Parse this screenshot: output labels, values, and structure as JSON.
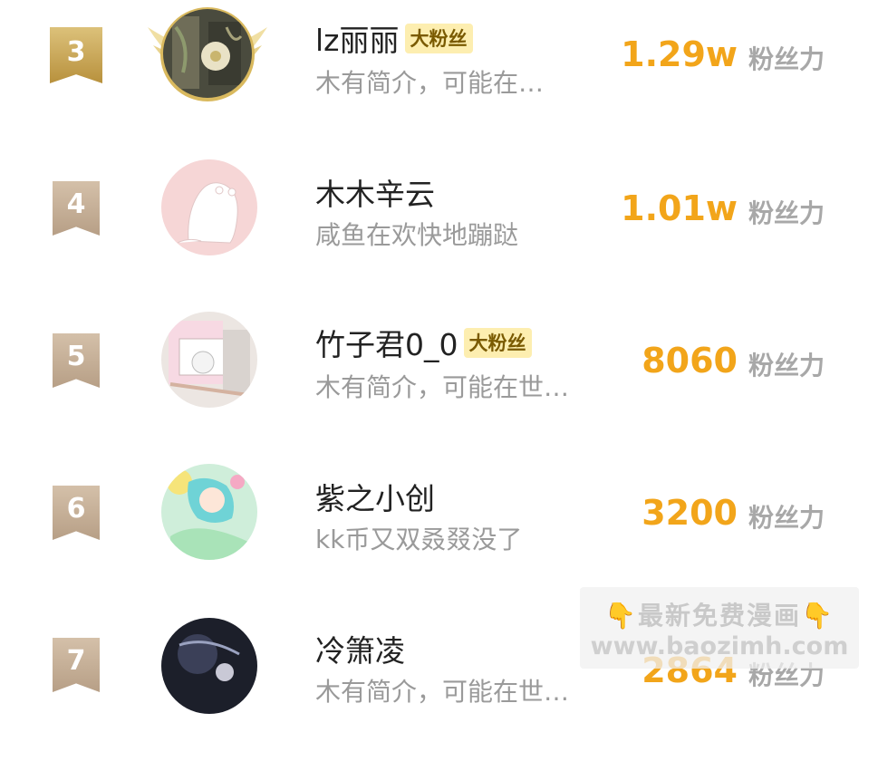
{
  "users": [
    {
      "rank": "3",
      "name": "lz丽丽",
      "badge": "大粉丝",
      "bio": "木有简介，可能在…",
      "score": "1.29w",
      "score_label": "粉丝力"
    },
    {
      "rank": "4",
      "name": "木木辛云",
      "badge": "",
      "bio": "咸鱼在欢快地蹦跶",
      "score": "1.01w",
      "score_label": "粉丝力"
    },
    {
      "rank": "5",
      "name": "竹子君0_0",
      "badge": "大粉丝",
      "bio": "木有简介，可能在世…",
      "score": "8060",
      "score_label": "粉丝力"
    },
    {
      "rank": "6",
      "name": "紫之小创",
      "badge": "",
      "bio": "kk币又双叒叕没了",
      "score": "3200",
      "score_label": "粉丝力"
    },
    {
      "rank": "7",
      "name": "冷箫凌",
      "badge": "",
      "bio": "木有简介，可能在世…",
      "score": "2864",
      "score_label": "粉丝力"
    }
  ],
  "watermark": {
    "line1": "最新免费漫画",
    "line2": "www.baozimh.com",
    "hand_icon": "👇"
  },
  "colors": {
    "score": "#f2a51a",
    "badge_bg": "#fdeeb0",
    "rank_gold": "#c9a24e",
    "rank_tan": "#c4ae95"
  }
}
